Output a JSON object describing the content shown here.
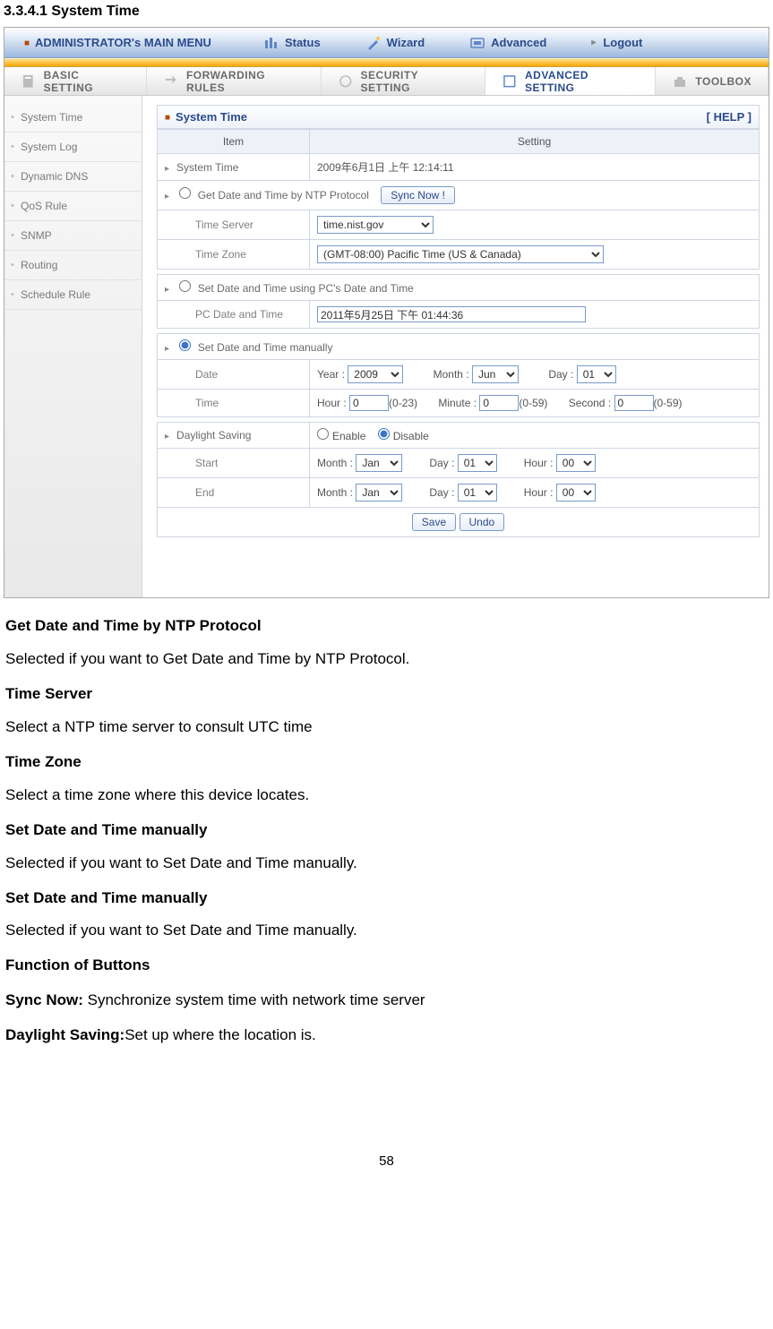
{
  "section_number": "3.3.4.1 System Time",
  "topbar": {
    "admin_label": "ADMINISTRATOR's MAIN MENU",
    "nav": [
      "Status",
      "Wizard",
      "Advanced",
      "Logout"
    ]
  },
  "tabs": {
    "basic": "BASIC SETTING",
    "forwarding": "FORWARDING RULES",
    "security": "SECURITY SETTING",
    "advanced": "ADVANCED SETTING",
    "toolbox": "TOOLBOX"
  },
  "sidebar": {
    "items": [
      "System Time",
      "System Log",
      "Dynamic DNS",
      "QoS Rule",
      "SNMP",
      "Routing",
      "Schedule Rule"
    ]
  },
  "panel": {
    "title": "System Time",
    "help": "[ HELP ]",
    "th_item": "Item",
    "th_setting": "Setting"
  },
  "rows": {
    "system_time_label": "System Time",
    "system_time_value": "2009年6月1日 上午 12:14:11",
    "ntp_label": "Get Date and Time by NTP Protocol",
    "sync_btn": "Sync Now !",
    "time_server_label": "Time Server",
    "time_server_value": "time.nist.gov",
    "time_zone_label": "Time Zone",
    "time_zone_value": "(GMT-08:00) Pacific Time (US & Canada)",
    "pc_label": "Set Date and Time using PC's Date and Time",
    "pc_date_label": "PC Date and Time",
    "pc_date_value": "2011年5月25日 下午 01:44:36",
    "manual_label": "Set Date and Time manually",
    "date_label": "Date",
    "date_year_lbl": "Year :",
    "date_year_val": "2009",
    "date_month_lbl": "Month :",
    "date_month_val": "Jun",
    "date_day_lbl": "Day :",
    "date_day_val": "01",
    "time_label": "Time",
    "time_hour_lbl": "Hour :",
    "time_hour_val": "0",
    "time_hour_hint": "(0-23)",
    "time_min_lbl": "Minute :",
    "time_min_val": "0",
    "time_min_hint": "(0-59)",
    "time_sec_lbl": "Second :",
    "time_sec_val": "0",
    "time_sec_hint": "(0-59)",
    "dst_label": "Daylight Saving",
    "dst_enable": "Enable",
    "dst_disable": "Disable",
    "start_label": "Start",
    "end_label": "End",
    "dst_month_lbl": "Month :",
    "dst_month_val": "Jan",
    "dst_day_lbl": "Day :",
    "dst_day_val": "01",
    "dst_hour_lbl": "Hour :",
    "dst_hour_val": "00",
    "save_btn": "Save",
    "undo_btn": "Undo"
  },
  "doc": {
    "h1": "Get Date and Time by NTP Protocol",
    "p1": "Selected if you want to Get Date and Time by NTP Protocol.",
    "h2": "Time Server",
    "p2": "Select a NTP time server to consult UTC time",
    "h3": "Time Zone",
    "p3": "Select a time zone where this device locates.",
    "h4": "Set Date and Time manually",
    "p4": "Selected if you want to Set Date and Time manually.",
    "h5": "Set Date and Time manually",
    "p5": "Selected if you want to Set Date and Time manually.",
    "h6": "Function of Buttons",
    "syncnow_bold": "Sync Now: ",
    "syncnow_text": "Synchronize system time with network time server",
    "dst_bold": "Daylight Saving:",
    "dst_text": "Set up where the location is."
  },
  "page_number": "58"
}
